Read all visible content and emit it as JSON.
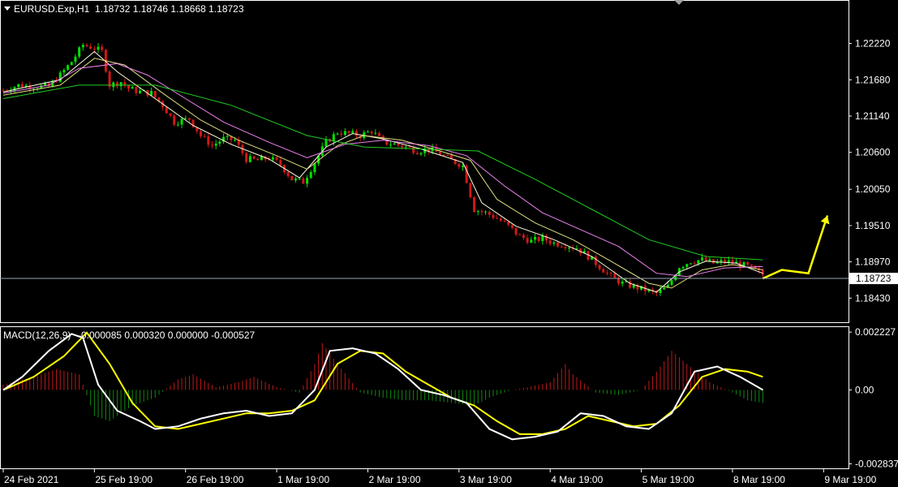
{
  "header": {
    "symbol": "EURUSD.Exp,H1",
    "ohlc": "1.18732 1.18746 1.18668 1.18723"
  },
  "macd": {
    "label": "MACD(12,26,9)",
    "values": "-0.000085 0.000320 0.000000 -0.000527"
  },
  "current_price": "1.18723",
  "colors": {
    "background": "#000000",
    "grid_border": "#ffffff",
    "bull": "#00e000",
    "bear": "#d01818",
    "ma_fast": "#ffffe0",
    "ma_mid": "#e0e080",
    "ma_slow": "#ee82ee",
    "ma_long": "#22cc22",
    "forecast": "#ffff00",
    "macd_main": "#ffffff",
    "macd_signal": "#ffff00",
    "hist_pos": "#c01818",
    "hist_neg": "#108a10"
  },
  "chart_data": [
    {
      "type": "candlestick",
      "title": "EURUSD.Exp,H1",
      "y_ticks": [
        "1.22220",
        "1.21680",
        "1.21140",
        "1.20600",
        "1.20050",
        "1.19510",
        "1.18970",
        "1.18430"
      ],
      "x_ticks": [
        "24 Feb 2021",
        "25 Feb 19:00",
        "26 Feb 19:00",
        "1 Mar 19:00",
        "2 Mar 19:00",
        "3 Mar 19:00",
        "4 Mar 19:00",
        "5 Mar 19:00",
        "8 Mar 19:00",
        "9 Mar 19:00"
      ],
      "ylim": [
        1.1818,
        1.2265
      ],
      "close_path": [
        [
          0,
          1.2152
        ],
        [
          4,
          1.216
        ],
        [
          8,
          1.2158
        ],
        [
          12,
          1.2158
        ],
        [
          15,
          1.2175
        ],
        [
          18,
          1.2195
        ],
        [
          21,
          1.222
        ],
        [
          24,
          1.2215
        ],
        [
          26,
          1.221
        ],
        [
          28,
          1.216
        ],
        [
          31,
          1.2165
        ],
        [
          33,
          1.2155
        ],
        [
          36,
          1.215
        ],
        [
          39,
          1.2148
        ],
        [
          42,
          1.213
        ],
        [
          45,
          1.2105
        ],
        [
          49,
          1.211
        ],
        [
          52,
          1.2085
        ],
        [
          55,
          1.207
        ],
        [
          58,
          1.208
        ],
        [
          61,
          1.2078
        ],
        [
          64,
          1.205
        ],
        [
          67,
          1.2048
        ],
        [
          70,
          1.2052
        ],
        [
          73,
          1.2042
        ],
        [
          76,
          1.202
        ],
        [
          79,
          1.2016
        ],
        [
          82,
          1.2045
        ],
        [
          85,
          1.2075
        ],
        [
          88,
          1.209
        ],
        [
          91,
          1.2088
        ],
        [
          94,
          1.2085
        ],
        [
          97,
          1.2092
        ],
        [
          100,
          1.2075
        ],
        [
          103,
          1.2072
        ],
        [
          106,
          1.2068
        ],
        [
          109,
          1.2062
        ],
        [
          112,
          1.2065
        ],
        [
          115,
          1.2058
        ],
        [
          118,
          1.2048
        ],
        [
          121,
          1.204
        ],
        [
          124,
          1.1975
        ],
        [
          127,
          1.197
        ],
        [
          130,
          1.1962
        ],
        [
          133,
          1.195
        ],
        [
          136,
          1.1935
        ],
        [
          139,
          1.1928
        ],
        [
          142,
          1.1932
        ],
        [
          145,
          1.1925
        ],
        [
          148,
          1.1922
        ],
        [
          151,
          1.1918
        ],
        [
          154,
          1.1905
        ],
        [
          157,
          1.189
        ],
        [
          160,
          1.1875
        ],
        [
          163,
          1.1865
        ],
        [
          166,
          1.186
        ],
        [
          169,
          1.1855
        ],
        [
          172,
          1.185
        ],
        [
          175,
          1.186
        ],
        [
          178,
          1.189
        ],
        [
          181,
          1.1898
        ],
        [
          184,
          1.19
        ],
        [
          187,
          1.1895
        ],
        [
          190,
          1.1898
        ],
        [
          193,
          1.1895
        ],
        [
          196,
          1.189
        ],
        [
          200,
          1.1878
        ]
      ],
      "moving_averages": [
        {
          "name": "",
          "points": [
            [
              0,
              1.215
            ],
            [
              15,
              1.2168
            ],
            [
              24,
              1.221
            ],
            [
              30,
              1.218
            ],
            [
              40,
              1.214
            ],
            [
              50,
              1.21
            ],
            [
              60,
              1.2072
            ],
            [
              70,
              1.205
            ],
            [
              78,
              1.2022
            ],
            [
              85,
              1.2068
            ],
            [
              92,
              1.2088
            ],
            [
              100,
              1.208
            ],
            [
              110,
              1.2065
            ],
            [
              121,
              1.2045
            ],
            [
              126,
              1.1985
            ],
            [
              135,
              1.195
            ],
            [
              145,
              1.193
            ],
            [
              155,
              1.1905
            ],
            [
              165,
              1.1865
            ],
            [
              172,
              1.1852
            ],
            [
              178,
              1.1882
            ],
            [
              185,
              1.1898
            ],
            [
              193,
              1.1895
            ],
            [
              200,
              1.188
            ]
          ]
        },
        {
          "name": "",
          "points": [
            [
              0,
              1.2145
            ],
            [
              15,
              1.216
            ],
            [
              24,
              1.22
            ],
            [
              32,
              1.219
            ],
            [
              42,
              1.2148
            ],
            [
              52,
              1.2108
            ],
            [
              62,
              1.2078
            ],
            [
              72,
              1.2055
            ],
            [
              80,
              1.2035
            ],
            [
              88,
              1.207
            ],
            [
              95,
              1.2085
            ],
            [
              105,
              1.2078
            ],
            [
              115,
              1.2062
            ],
            [
              123,
              1.2048
            ],
            [
              130,
              1.199
            ],
            [
              140,
              1.1955
            ],
            [
              150,
              1.193
            ],
            [
              160,
              1.1898
            ],
            [
              170,
              1.1865
            ],
            [
              176,
              1.1858
            ],
            [
              184,
              1.1885
            ],
            [
              192,
              1.1893
            ],
            [
              200,
              1.1885
            ]
          ]
        },
        {
          "name": "",
          "points": [
            [
              0,
              1.2148
            ],
            [
              12,
              1.216
            ],
            [
              20,
              1.2185
            ],
            [
              30,
              1.2192
            ],
            [
              38,
              1.2175
            ],
            [
              48,
              1.214
            ],
            [
              58,
              1.2105
            ],
            [
              70,
              1.2075
            ],
            [
              80,
              1.2052
            ],
            [
              90,
              1.2072
            ],
            [
              100,
              1.2078
            ],
            [
              112,
              1.207
            ],
            [
              122,
              1.2055
            ],
            [
              132,
              1.201
            ],
            [
              142,
              1.197
            ],
            [
              152,
              1.1945
            ],
            [
              162,
              1.192
            ],
            [
              172,
              1.188
            ],
            [
              180,
              1.1875
            ],
            [
              190,
              1.1888
            ],
            [
              200,
              1.189
            ]
          ]
        },
        {
          "name": "",
          "points": [
            [
              0,
              1.214
            ],
            [
              20,
              1.216
            ],
            [
              40,
              1.216
            ],
            [
              60,
              1.213
            ],
            [
              80,
              1.2085
            ],
            [
              95,
              1.2068
            ],
            [
              110,
              1.2065
            ],
            [
              125,
              1.2062
            ],
            [
              140,
              1.202
            ],
            [
              155,
              1.1975
            ],
            [
              170,
              1.193
            ],
            [
              185,
              1.1905
            ],
            [
              200,
              1.19
            ]
          ]
        }
      ],
      "forecast_arrow": [
        [
          200,
          1.18723
        ],
        [
          205,
          1.1885
        ],
        [
          212,
          1.188
        ],
        [
          217,
          1.1966
        ]
      ]
    },
    {
      "type": "macd",
      "title": "MACD(12,26,9)",
      "y_ticks": [
        "0.002227",
        "0.00",
        "-0.002837"
      ],
      "ylim": [
        -0.00295,
        0.00235
      ],
      "main": [
        [
          0,
          0.0
        ],
        [
          5,
          0.0005
        ],
        [
          12,
          0.0015
        ],
        [
          18,
          0.00215
        ],
        [
          21,
          0.002
        ],
        [
          25,
          0.0002
        ],
        [
          30,
          -0.0008
        ],
        [
          36,
          -0.0012
        ],
        [
          40,
          -0.0015
        ],
        [
          46,
          -0.0014
        ],
        [
          52,
          -0.0011
        ],
        [
          58,
          -0.0009
        ],
        [
          64,
          -0.0008
        ],
        [
          70,
          -0.001
        ],
        [
          76,
          -0.0009
        ],
        [
          82,
          0.0
        ],
        [
          86,
          0.0015
        ],
        [
          92,
          0.0016
        ],
        [
          98,
          0.0014
        ],
        [
          104,
          0.0008
        ],
        [
          110,
          0.0
        ],
        [
          116,
          -0.0002
        ],
        [
          122,
          -0.0005
        ],
        [
          128,
          -0.0015
        ],
        [
          134,
          -0.0019
        ],
        [
          140,
          -0.0018
        ],
        [
          146,
          -0.0016
        ],
        [
          152,
          -0.0009
        ],
        [
          158,
          -0.001
        ],
        [
          164,
          -0.0014
        ],
        [
          170,
          -0.0015
        ],
        [
          176,
          -0.0009
        ],
        [
          182,
          0.0007
        ],
        [
          188,
          0.0009
        ],
        [
          194,
          0.0005
        ],
        [
          200,
          0.0
        ]
      ],
      "signal": [
        [
          0,
          0.0
        ],
        [
          8,
          0.0005
        ],
        [
          16,
          0.0013
        ],
        [
          22,
          0.0022
        ],
        [
          28,
          0.001
        ],
        [
          34,
          -0.0005
        ],
        [
          40,
          -0.0014
        ],
        [
          46,
          -0.0015
        ],
        [
          52,
          -0.0013
        ],
        [
          58,
          -0.0011
        ],
        [
          64,
          -0.0009
        ],
        [
          70,
          -0.0009
        ],
        [
          76,
          -0.0008
        ],
        [
          82,
          -0.0004
        ],
        [
          88,
          0.001
        ],
        [
          94,
          0.0015
        ],
        [
          100,
          0.0014
        ],
        [
          106,
          0.0007
        ],
        [
          112,
          0.0002
        ],
        [
          118,
          -0.0003
        ],
        [
          124,
          -0.0006
        ],
        [
          130,
          -0.0012
        ],
        [
          136,
          -0.0017
        ],
        [
          142,
          -0.0017
        ],
        [
          148,
          -0.0015
        ],
        [
          154,
          -0.001
        ],
        [
          160,
          -0.0012
        ],
        [
          166,
          -0.0014
        ],
        [
          172,
          -0.0013
        ],
        [
          178,
          -0.0006
        ],
        [
          184,
          0.0005
        ],
        [
          190,
          0.0008
        ],
        [
          196,
          0.0007
        ],
        [
          200,
          0.0005
        ]
      ],
      "histogram_envelope": [
        [
          0,
          0.0002
        ],
        [
          8,
          0.0005
        ],
        [
          14,
          0.0008
        ],
        [
          20,
          0.0006
        ],
        [
          24,
          -0.001
        ],
        [
          28,
          -0.0012
        ],
        [
          34,
          -0.0006
        ],
        [
          40,
          -0.0003
        ],
        [
          46,
          0.0004
        ],
        [
          50,
          0.0006
        ],
        [
          56,
          0.0001
        ],
        [
          62,
          0.0003
        ],
        [
          66,
          0.0005
        ],
        [
          72,
          0.0001
        ],
        [
          78,
          -0.0001
        ],
        [
          82,
          0.001
        ],
        [
          84,
          0.0018
        ],
        [
          88,
          0.001
        ],
        [
          94,
          -0.0001
        ],
        [
          100,
          -0.0003
        ],
        [
          106,
          -0.0004
        ],
        [
          112,
          -0.0004
        ],
        [
          118,
          -0.0005
        ],
        [
          124,
          -0.0006
        ],
        [
          128,
          -0.0003
        ],
        [
          134,
          0.0
        ],
        [
          138,
          0.0001
        ],
        [
          144,
          0.0003
        ],
        [
          148,
          0.001
        ],
        [
          150,
          0.0006
        ],
        [
          156,
          -0.0001
        ],
        [
          162,
          -0.0002
        ],
        [
          168,
          0.0
        ],
        [
          172,
          0.0007
        ],
        [
          176,
          0.0015
        ],
        [
          180,
          0.001
        ],
        [
          186,
          0.0003
        ],
        [
          192,
          -0.0001
        ],
        [
          196,
          -0.0004
        ],
        [
          200,
          -0.0005
        ]
      ]
    }
  ]
}
